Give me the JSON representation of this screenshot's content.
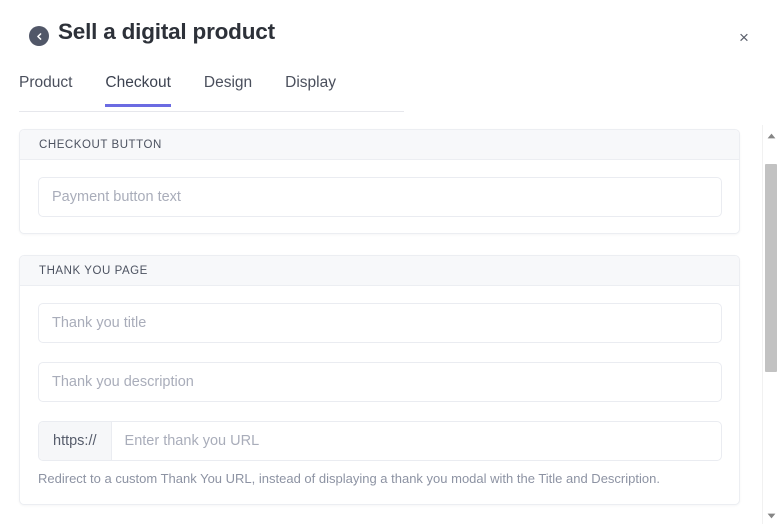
{
  "header": {
    "title": "Sell a digital product",
    "back_icon": "chevron-left-icon",
    "close_icon": "close-icon",
    "close_glyph": "×"
  },
  "tabs": {
    "active": "Checkout",
    "items": [
      {
        "label": "Product"
      },
      {
        "label": "Checkout"
      },
      {
        "label": "Design"
      },
      {
        "label": "Display"
      }
    ]
  },
  "sections": {
    "checkout_button": {
      "heading": "CHECKOUT BUTTON",
      "payment_button_text": {
        "value": "",
        "placeholder": "Payment button text"
      }
    },
    "thank_you_page": {
      "heading": "THANK YOU PAGE",
      "title_field": {
        "value": "",
        "placeholder": "Thank you title"
      },
      "description_field": {
        "value": "",
        "placeholder": "Thank you description"
      },
      "url_field": {
        "prefix": "https://",
        "value": "",
        "placeholder": "Enter thank you URL"
      },
      "url_helper": "Redirect to a custom Thank You URL, instead of displaying a thank you modal with the Title and Description."
    }
  },
  "scrollbar": {
    "up_icon": "triangle-up-icon",
    "down_icon": "triangle-down-icon"
  },
  "colors": {
    "accent": "#6b6be2",
    "title": "#2d3139",
    "placeholder": "#a9adba",
    "section_header_bg": "#f7f8fa",
    "back_button_bg": "#515768"
  }
}
